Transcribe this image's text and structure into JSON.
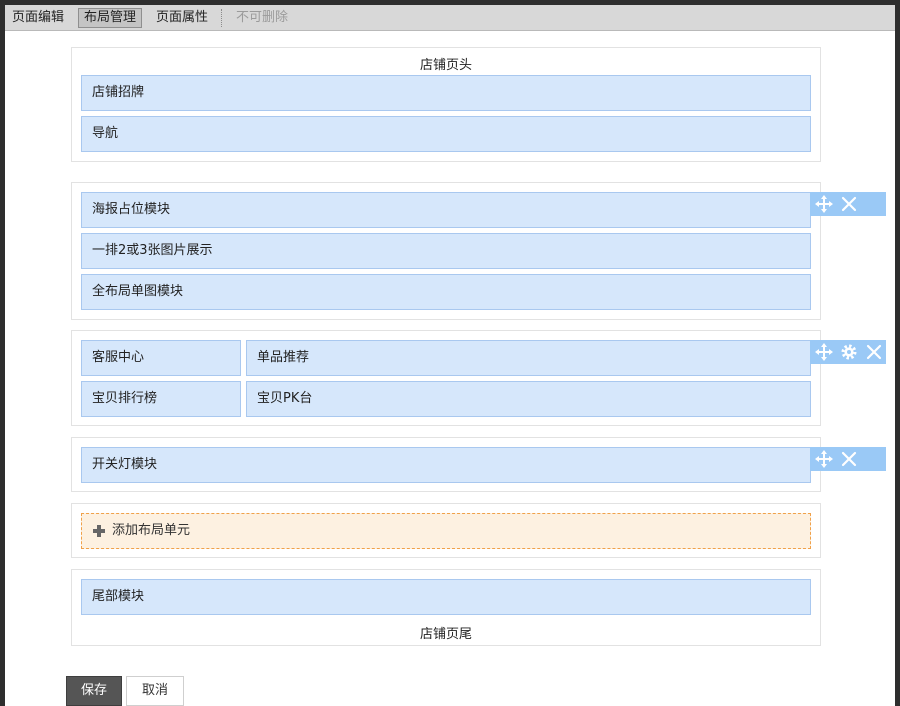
{
  "tabs": [
    {
      "label": "页面编辑",
      "state": "normal"
    },
    {
      "label": "布局管理",
      "state": "active"
    },
    {
      "label": "页面属性",
      "state": "normal"
    },
    {
      "label": "不可删除",
      "state": "disabled"
    }
  ],
  "header_section": {
    "caption": "店铺页头",
    "modules": [
      "店铺招牌",
      "导航"
    ]
  },
  "layout_units": [
    {
      "modules": [
        "海报占位模块",
        "一排2或3张图片展示",
        "全布局单图模块"
      ],
      "tools": [
        "move-icon",
        "close-icon"
      ]
    },
    {
      "left_column": [
        "客服中心",
        "宝贝排行榜"
      ],
      "right_column": [
        "单品推荐",
        "宝贝PK台"
      ],
      "tools": [
        "move-icon",
        "gear-icon",
        "close-icon"
      ]
    },
    {
      "modules": [
        "开关灯模块"
      ],
      "tools": [
        "move-icon",
        "close-icon"
      ]
    }
  ],
  "add_unit_label": "添加布局单元",
  "footer_section": {
    "modules": [
      "尾部模块"
    ],
    "caption": "店铺页尾"
  },
  "buttons": {
    "save_label": "保存",
    "cancel_label": "取消"
  },
  "colors": {
    "module_fill": "#d6e7fb",
    "module_border": "#a9c8ef",
    "toolbox": "#9ac9f6",
    "add_unit_fill": "#fdf1e1",
    "add_unit_border": "#f0a14a",
    "save_button": "#555555"
  }
}
